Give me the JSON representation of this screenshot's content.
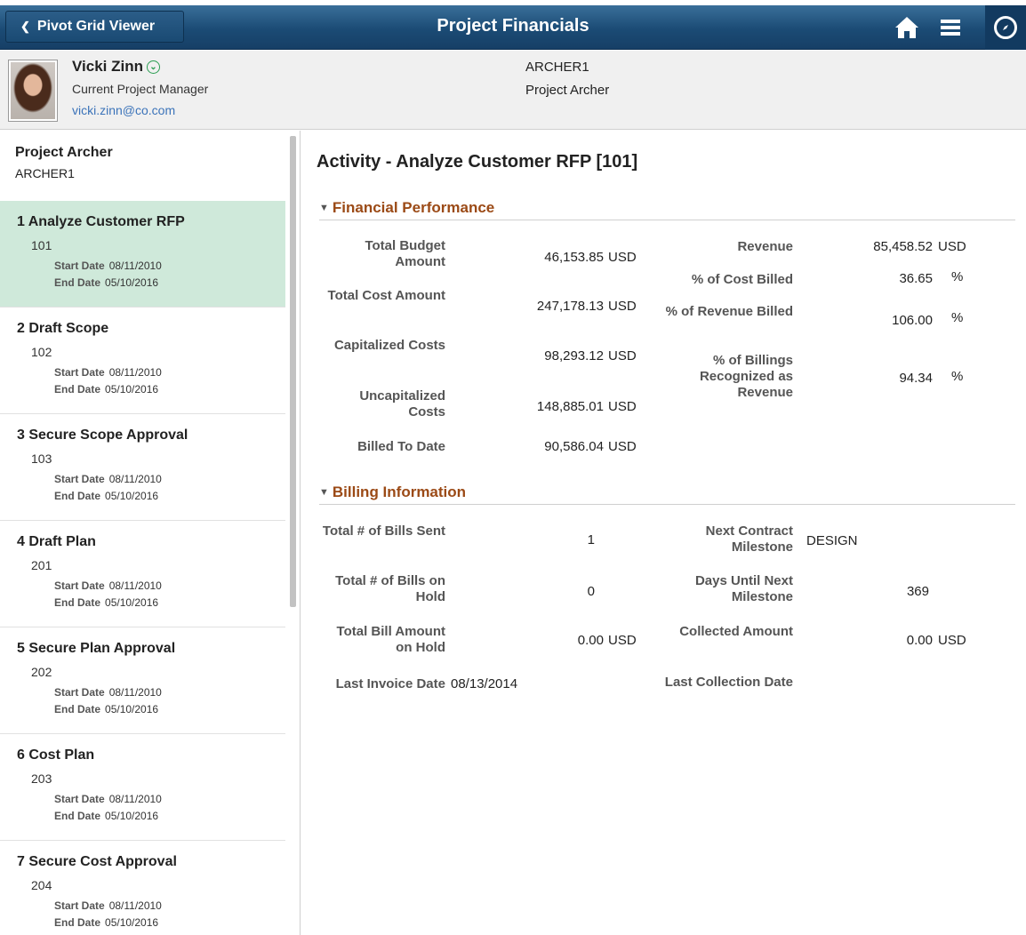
{
  "header": {
    "back_label": "Pivot Grid Viewer",
    "title": "Project Financials"
  },
  "context": {
    "person_name": "Vicki Zinn",
    "person_role": "Current Project Manager",
    "person_email": "vicki.zinn@co.com",
    "project_code": "ARCHER1",
    "project_name": "Project Archer"
  },
  "sidebar": {
    "title": "Project Archer",
    "subtitle": "ARCHER1",
    "start_label": "Start Date",
    "end_label": "End Date",
    "items": [
      {
        "title": "1 Analyze Customer RFP",
        "num": "101",
        "start": "08/11/2010",
        "end": "05/10/2016"
      },
      {
        "title": "2 Draft Scope",
        "num": "102",
        "start": "08/11/2010",
        "end": "05/10/2016"
      },
      {
        "title": "3 Secure Scope Approval",
        "num": "103",
        "start": "08/11/2010",
        "end": "05/10/2016"
      },
      {
        "title": "4 Draft Plan",
        "num": "201",
        "start": "08/11/2010",
        "end": "05/10/2016"
      },
      {
        "title": "5 Secure Plan Approval",
        "num": "202",
        "start": "08/11/2010",
        "end": "05/10/2016"
      },
      {
        "title": "6 Cost Plan",
        "num": "203",
        "start": "08/11/2010",
        "end": "05/10/2016"
      },
      {
        "title": "7 Secure Cost Approval",
        "num": "204",
        "start": "08/11/2010",
        "end": "05/10/2016"
      }
    ]
  },
  "main": {
    "title": "Activity - Analyze Customer RFP [101]",
    "financial": {
      "heading": "Financial Performance",
      "total_budget_label": "Total Budget Amount",
      "total_budget_value": "46,153.85",
      "total_cost_label": "Total Cost Amount",
      "total_cost_value": "247,178.13",
      "capitalized_label": "Capitalized Costs",
      "capitalized_value": "98,293.12",
      "uncapitalized_label": "Uncapitalized Costs",
      "uncapitalized_value": "148,885.01",
      "billed_label": "Billed To Date",
      "billed_value": "90,586.04",
      "revenue_label": "Revenue",
      "revenue_value": "85,458.52",
      "cost_billed_label": "% of Cost Billed",
      "cost_billed_value": "36.65",
      "revenue_billed_label": "% of Revenue Billed",
      "revenue_billed_value": "106.00",
      "billings_recognized_label": "% of Billings Recognized as Revenue",
      "billings_recognized_value": "94.34",
      "currency": "USD",
      "percent": "%"
    },
    "billing": {
      "heading": "Billing Information",
      "bills_sent_label": "Total # of Bills Sent",
      "bills_sent_value": "1",
      "bills_hold_label": "Total # of Bills on Hold",
      "bills_hold_value": "0",
      "bill_amount_hold_label": "Total Bill Amount on Hold",
      "bill_amount_hold_value": "0.00",
      "last_invoice_label": "Last Invoice Date",
      "last_invoice_value": "08/13/2014",
      "next_milestone_label": "Next Contract Milestone",
      "next_milestone_value": "DESIGN",
      "days_until_label": "Days Until Next Milestone",
      "days_until_value": "369",
      "collected_label": "Collected Amount",
      "collected_value": "0.00",
      "last_collection_label": "Last Collection Date",
      "currency": "USD"
    }
  }
}
